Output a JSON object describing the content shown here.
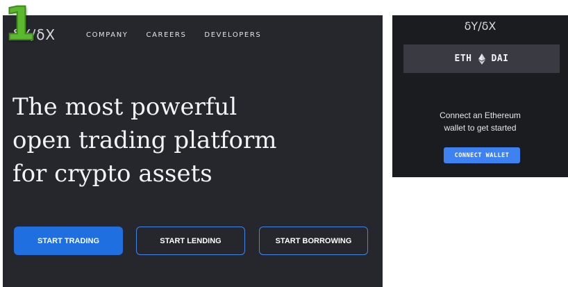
{
  "badge": {
    "number": "1"
  },
  "landing": {
    "logo": "δY/δX",
    "nav": [
      {
        "label": "COMPANY"
      },
      {
        "label": "CAREERS"
      },
      {
        "label": "DEVELOPERS"
      }
    ],
    "hero_lines": [
      "The most powerful",
      "open trading platform",
      "for crypto assets"
    ],
    "buttons": {
      "trade": "START TRADING",
      "lend": "START LENDING",
      "borrow": "START BORROWING"
    }
  },
  "widget": {
    "logo": "δY/δX",
    "pair": {
      "base": "ETH",
      "quote": "DAI",
      "icon": "ethereum-icon"
    },
    "message_lines": [
      "Connect an Ethereum",
      "wallet to get started"
    ],
    "connect_label": "CONNECT WALLET"
  },
  "colors": {
    "landing_bg": "#25272d",
    "widget_bg": "#1b1c20",
    "primary": "#1f6fe0",
    "outline": "#3f86ea",
    "badge_green": "#5cb82e"
  }
}
